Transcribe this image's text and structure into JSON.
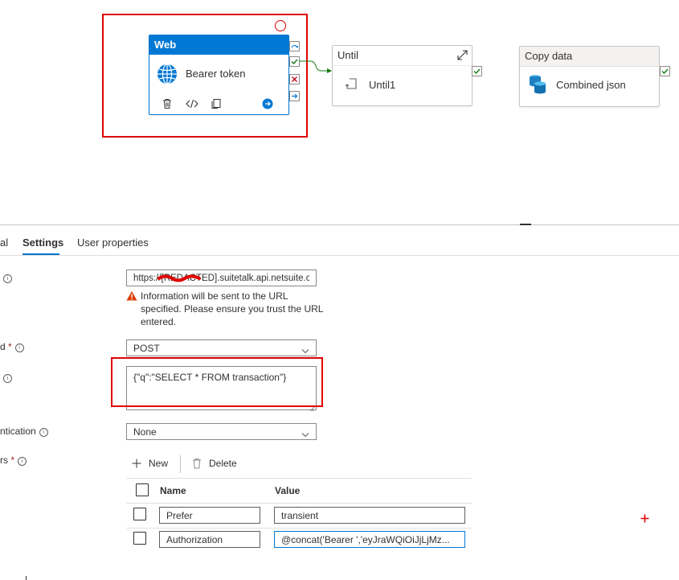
{
  "pipeline": {
    "web_activity": {
      "type_label": "Web",
      "name": "Bearer token"
    },
    "until_activity": {
      "type_label": "Until",
      "name": "Until1"
    },
    "copy_activity": {
      "type_label": "Copy data",
      "name": "Combined json"
    }
  },
  "tabs": [
    {
      "label": "al"
    },
    {
      "label": "Settings",
      "selected": true
    },
    {
      "label": "User properties"
    }
  ],
  "settings": {
    "url": {
      "label_fragment": "",
      "value": "https://[REDACTED].suitetalk.api.netsuite.co...",
      "warning": "Information will be sent to the URL specified. Please ensure you trust the URL entered."
    },
    "method": {
      "label_fragment": "d",
      "value": "POST"
    },
    "body": {
      "label_fragment": "",
      "value": "{\"q\":\"SELECT * FROM transaction\"}"
    },
    "authentication": {
      "label_fragment": "ntication",
      "value": "None"
    },
    "headers": {
      "label_fragment": "rs",
      "new_label": "New",
      "delete_label": "Delete",
      "columns": [
        "Name",
        "Value"
      ],
      "rows": [
        {
          "name": "Prefer",
          "value": "transient"
        },
        {
          "name": "Authorization",
          "value": "@concat('Bearer ','eyJraWQiOiJjLjMz..."
        }
      ]
    }
  },
  "colors": {
    "accent": "#0078d4",
    "success": "#107c10",
    "error": "#e00000",
    "warning": "#d83b01"
  }
}
